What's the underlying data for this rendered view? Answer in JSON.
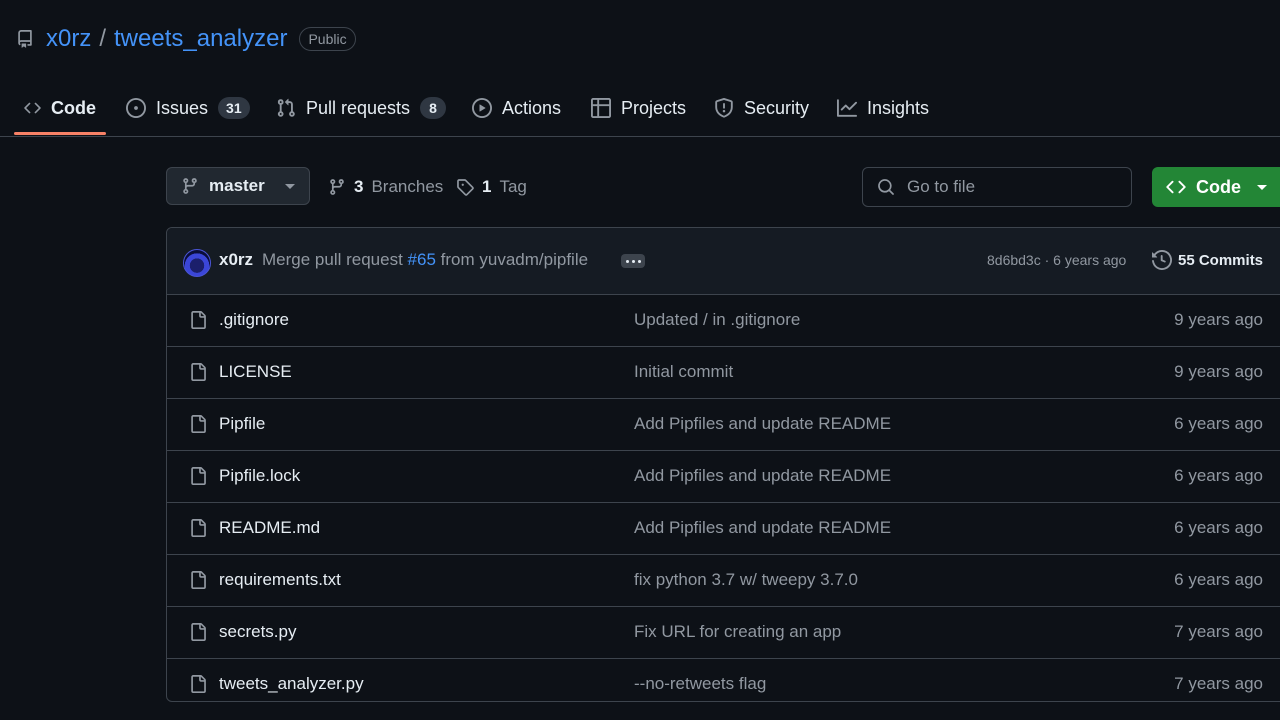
{
  "repo": {
    "owner": "x0rz",
    "separator": "/",
    "name": "tweets_analyzer",
    "visibility": "Public"
  },
  "tabs": [
    {
      "label": "Code",
      "icon": "code-icon",
      "active": true
    },
    {
      "label": "Issues",
      "icon": "issue-icon",
      "count": "31"
    },
    {
      "label": "Pull requests",
      "icon": "pull-request-icon",
      "count": "8"
    },
    {
      "label": "Actions",
      "icon": "play-icon"
    },
    {
      "label": "Projects",
      "icon": "table-icon"
    },
    {
      "label": "Security",
      "icon": "shield-icon"
    },
    {
      "label": "Insights",
      "icon": "graph-icon"
    }
  ],
  "toolbar": {
    "branch": "master",
    "branches_count": "3",
    "branches_label": "Branches",
    "tags_count": "1",
    "tags_label": "Tag",
    "search_placeholder": "Go to file",
    "code_button": "Code"
  },
  "latest_commit": {
    "author": "x0rz",
    "message_prefix": "Merge pull request",
    "pr_ref": "#65",
    "message_suffix": "from yuvadm/pipfile",
    "hash_age": "8d6bd3c · 6 years ago",
    "commits_count": "55 Commits"
  },
  "files": [
    {
      "name": ".gitignore",
      "message": "Updated / in .gitignore",
      "age": "9 years ago"
    },
    {
      "name": "LICENSE",
      "message": "Initial commit",
      "age": "9 years ago"
    },
    {
      "name": "Pipfile",
      "message": "Add Pipfiles and update README",
      "age": "6 years ago"
    },
    {
      "name": "Pipfile.lock",
      "message": "Add Pipfiles and update README",
      "age": "6 years ago"
    },
    {
      "name": "README.md",
      "message": "Add Pipfiles and update README",
      "age": "6 years ago"
    },
    {
      "name": "requirements.txt",
      "message": "fix python 3.7 w/ tweepy 3.7.0",
      "age": "6 years ago"
    },
    {
      "name": "secrets.py",
      "message": "Fix URL for creating an app",
      "age": "7 years ago"
    },
    {
      "name": "tweets_analyzer.py",
      "message": "--no-retweets flag",
      "age": "7 years ago"
    }
  ],
  "colors": {
    "accent_link": "#4493f8",
    "active_tab_underline": "#f78166",
    "code_button": "#238636",
    "background": "#0d1117"
  }
}
